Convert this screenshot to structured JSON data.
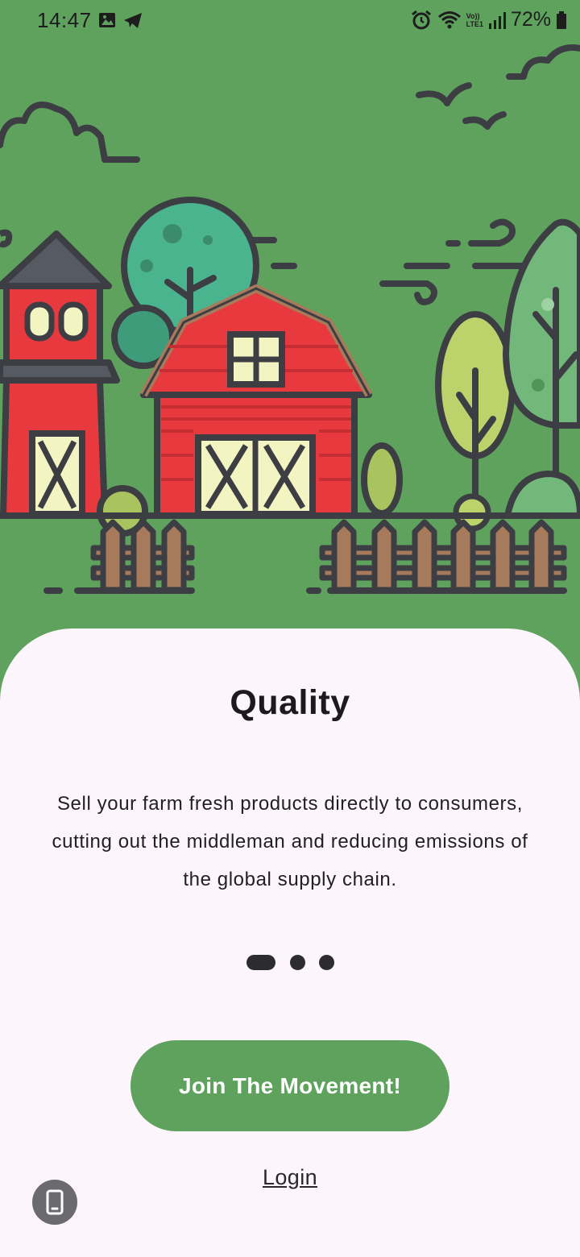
{
  "status_bar": {
    "time": "14:47",
    "battery_percent": "72%",
    "network_label": "LTE1",
    "volte_label": "Vo))",
    "icons": [
      "image-icon",
      "telegram-icon",
      "alarm-icon",
      "wifi-icon",
      "signal-icon",
      "battery-icon"
    ]
  },
  "hero": {
    "illustration": "farm-scene-illustration",
    "background_color": "#5fa25e"
  },
  "onboarding": {
    "title": "Quality",
    "description": "Sell your farm fresh products directly to consumers, cutting out the middleman and reducing emissions of the global supply chain.",
    "pager": {
      "total": 3,
      "active": 1
    },
    "primary_button_label": "Join The Movement!",
    "secondary_link_label": "Login"
  },
  "overlay": {
    "floating_button_icon": "phone-icon"
  },
  "colors": {
    "accent": "#5fa25e",
    "sheet": "#fcf6fc",
    "barn_red": "#e8393f"
  }
}
